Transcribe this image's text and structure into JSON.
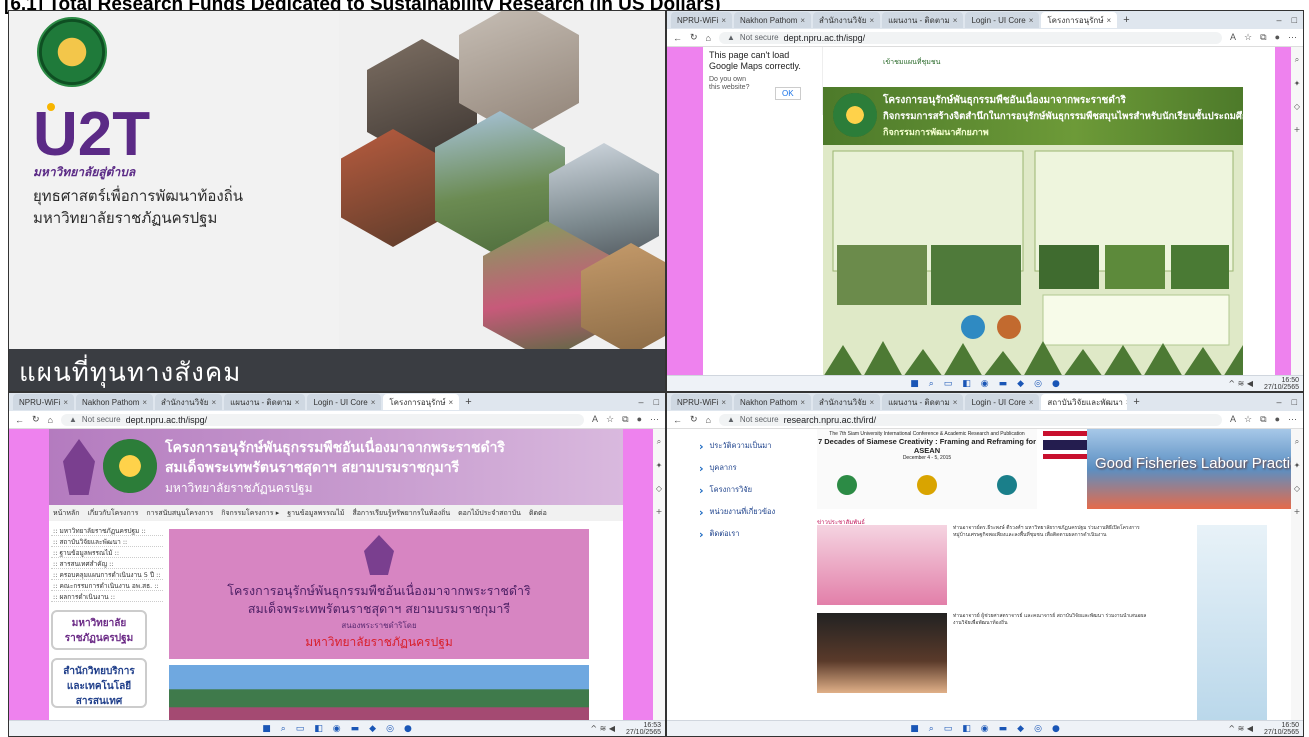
{
  "title": "[6.1] Total Research Funds Dedicated to Sustainability Research (in US Dollars)",
  "panel1": {
    "logo_text": "U2T",
    "logo_subtitle": "มหาวิทยาลัยสู่ตำบล",
    "strategy_line1": "ยุทธศาสตร์เพื่อการพัฒนาท้องถิ่น",
    "strategy_line2": "มหาวิทยาลัยราชภัฏนครปฐม",
    "footer_text": "แผนที่ทุนทางสังคม"
  },
  "browser_common": {
    "tabs": [
      "NPRU-WiFi",
      "Nakhon Pathom",
      "สำนักงานวิจัย",
      "แผนงาน - ติดตาม",
      "Login - UI Core",
      "สถาบันวิจัยและพัฒนา",
      "โครงการอนุรักษ์"
    ],
    "not_secure": "Not secure",
    "taskbar_time": "16:50",
    "taskbar_time2": "16:53",
    "taskbar_date": "27/10/2565"
  },
  "panel2": {
    "url": "dept.npru.ac.th/ispg/",
    "gmap_message": "This page can't load Google Maps correctly.",
    "gmap_question": "Do you own this website?",
    "gmap_ok": "OK",
    "map_link": "เข้าชมแผนที่ชุมชน",
    "poster_title1": "โครงการอนุรักษ์พันธุกรรมพืชอันเนื่องมาจากพระราชดำริ",
    "poster_title2": "กิจกรรมการสร้างจิตสำนึกในการอนุรักษ์พันธุกรรมพืชสมุนไพรสำหรับนักเรียนชั้นประถมศึกษา",
    "poster_title3": "กิจกรรมการพัฒนาศักยภาพ"
  },
  "panel3": {
    "url": "dept.npru.ac.th/ispg/",
    "header_line1": "โครงการอนุรักษ์พันธุกรรมพืชอันเนื่องมาจากพระราชดำริ",
    "header_line2": "สมเด็จพระเทพรัตนราชสุดาฯ สยามบรมราชกุมารี",
    "header_line3": "มหาวิทยาลัยราชภัฏนครปฐม",
    "menu": [
      "หน้าหลัก",
      "เกี่ยวกับโครงการ",
      "การสนับสนุนโครงการ",
      "กิจกรรมโครงการ ▸",
      "ฐานข้อมูลพรรณไม้",
      "สื่อการเรียนรู้ทรัพยากรในท้องถิ่น",
      "ดอกไม้ประจำสถาบัน",
      "ติดต่อ"
    ],
    "side_links": [
      ":: มหาวิทยาลัยราชภัฏนครปฐม ::",
      ":: สถาบันวิจัยและพัฒนา ::",
      ":: ฐานข้อมูลพรรณไม้ ::",
      ":: สารสนเทศสำคัญ ::",
      ":: ครอบคลุมแผนการดำเนินงาน 5 ปี ::",
      ":: คณะกรรมการดำเนินงาน อพ.สธ. ::",
      ":: ผลการดำเนินงาน ::"
    ],
    "btn1_line1": "มหาวิทยาลัย",
    "btn1_line2": "ราชภัฏนครปฐม",
    "btn2_line1": "สำนักวิทยบริการ",
    "btn2_line2": "และเทคโนโลยี",
    "btn2_line3": "สารสนเทศ",
    "banner_line1": "โครงการอนุรักษ์พันธุกรรมพืชอันเนื่องมาจากพระราชดำริ",
    "banner_line2": "สมเด็จพระเทพรัตนราชสุดาฯ สยามบรมราชกุมารี",
    "banner_line3": "สนองพระราชดำริโดย",
    "banner_line4": "มหาวิทยาลัยราชภัฏนครปฐม"
  },
  "panel4": {
    "url": "research.npru.ac.th/ird/",
    "nav": [
      "ประวัติความเป็นมา",
      "บุคลากร",
      "โครงการวิจัย",
      "หน่วยงานที่เกี่ยวข้อง",
      "ติดต่อเรา"
    ],
    "conf_line1": "The 7th Siam University International Conference & Academic Research and Publication",
    "conf_line2": "7 Decades of Siamese Creativity : Framing and Reframing for ASEAN",
    "conf_line3": "December 4 - 5, 2015",
    "banner_text": "Good Fisheries Labour Practices",
    "news_title": "ข่าวประชาสัมพันธ์",
    "news1_text": "ท่านอาจารย์ดร.ธีระพงษ์ ตีรวงศ์ฯ มหาวิทยาลัยราชภัฏนครปฐม ร่วมงานพิธีเปิดโครงการหมู่บ้านเศรษฐกิจพอเพียงและลงพื้นที่ชุมชน เพื่อติดตามผลการดำเนินงาน",
    "news2_text": "ท่านอาจารย์ ผู้ช่วยศาสตราจารย์ และคณาจารย์ สถาบันวิจัยและพัฒนา ร่วมงานนำเสนอผลงานวิจัยเพื่อพัฒนาท้องถิ่น"
  }
}
